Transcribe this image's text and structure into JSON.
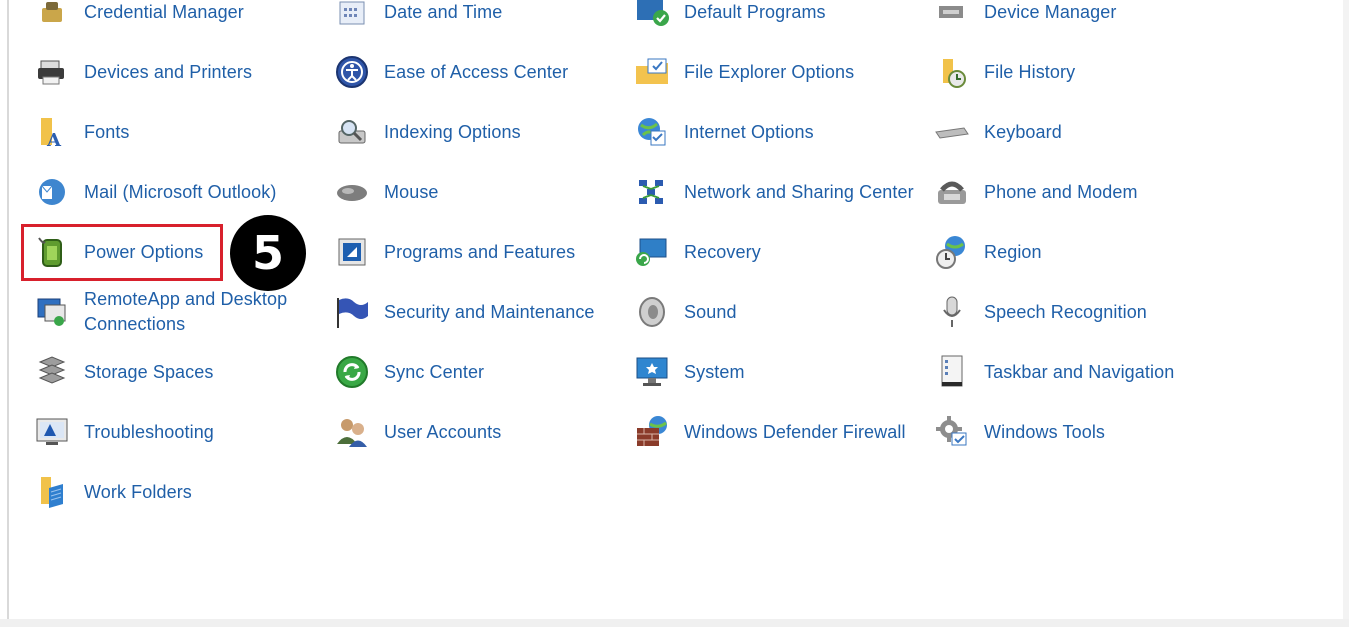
{
  "items": [
    {
      "label": "Credential Manager",
      "icon": "credential-manager-icon"
    },
    {
      "label": "Date and Time",
      "icon": "date-time-icon"
    },
    {
      "label": "Default Programs",
      "icon": "default-programs-icon"
    },
    {
      "label": "Device Manager",
      "icon": "device-manager-icon"
    },
    {
      "label": "Devices and Printers",
      "icon": "printer-icon"
    },
    {
      "label": "Ease of Access Center",
      "icon": "ease-of-access-icon"
    },
    {
      "label": "File Explorer Options",
      "icon": "folder-options-icon"
    },
    {
      "label": "File History",
      "icon": "file-history-icon"
    },
    {
      "label": "Fonts",
      "icon": "fonts-icon"
    },
    {
      "label": "Indexing Options",
      "icon": "indexing-icon"
    },
    {
      "label": "Internet Options",
      "icon": "internet-options-icon"
    },
    {
      "label": "Keyboard",
      "icon": "keyboard-icon"
    },
    {
      "label": "Mail (Microsoft Outlook)",
      "icon": "mail-icon"
    },
    {
      "label": "Mouse",
      "icon": "mouse-icon"
    },
    {
      "label": "Network and Sharing Center",
      "icon": "network-icon"
    },
    {
      "label": "Phone and Modem",
      "icon": "phone-modem-icon"
    },
    {
      "label": "Power Options",
      "icon": "power-options-icon"
    },
    {
      "label": "Programs and Features",
      "icon": "programs-features-icon"
    },
    {
      "label": "Recovery",
      "icon": "recovery-icon"
    },
    {
      "label": "Region",
      "icon": "region-icon"
    },
    {
      "label": "RemoteApp and Desktop Connections",
      "icon": "remoteapp-icon"
    },
    {
      "label": "Security and Maintenance",
      "icon": "security-flag-icon"
    },
    {
      "label": "Sound",
      "icon": "speaker-icon"
    },
    {
      "label": "Speech Recognition",
      "icon": "microphone-icon"
    },
    {
      "label": "Storage Spaces",
      "icon": "storage-spaces-icon"
    },
    {
      "label": "Sync Center",
      "icon": "sync-icon"
    },
    {
      "label": "System",
      "icon": "system-monitor-icon"
    },
    {
      "label": "Taskbar and Navigation",
      "icon": "taskbar-icon"
    },
    {
      "label": "Troubleshooting",
      "icon": "troubleshooting-icon"
    },
    {
      "label": "User Accounts",
      "icon": "user-accounts-icon"
    },
    {
      "label": "Windows Defender Firewall",
      "icon": "firewall-icon"
    },
    {
      "label": "Windows Tools",
      "icon": "gear-icon"
    },
    {
      "label": "Work Folders",
      "icon": "work-folders-icon"
    }
  ],
  "annotation": {
    "step": "5"
  },
  "colors": {
    "link": "#1f5fa8",
    "highlight": "#d8202c",
    "badge": "#000000"
  }
}
